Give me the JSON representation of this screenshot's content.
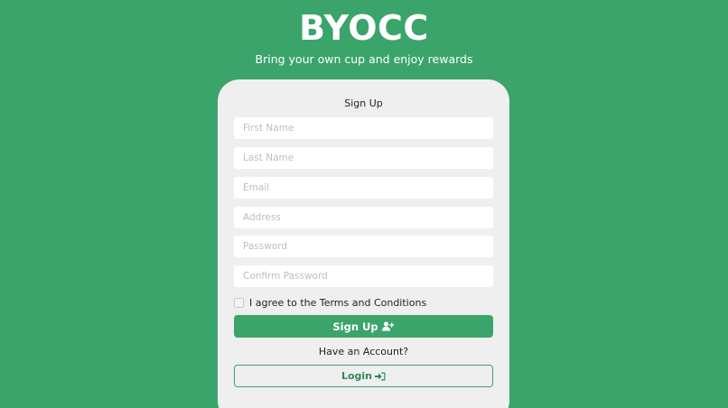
{
  "header": {
    "brand": "BYOCC",
    "tagline": "Bring your own cup and enjoy rewards"
  },
  "form": {
    "title": "Sign Up",
    "fields": [
      {
        "name": "first-name",
        "placeholder": "First Name",
        "value": ""
      },
      {
        "name": "last-name",
        "placeholder": "Last Name",
        "value": ""
      },
      {
        "name": "email",
        "placeholder": "Email",
        "value": ""
      },
      {
        "name": "address",
        "placeholder": "Address",
        "value": ""
      },
      {
        "name": "password",
        "placeholder": "Password",
        "value": ""
      },
      {
        "name": "confirm-password",
        "placeholder": "Confirm Password",
        "value": ""
      }
    ],
    "agree_label": "I agree to the Terms and Conditions",
    "agree_checked": false,
    "signup_label": "Sign Up",
    "signup_icon": "user-plus-icon",
    "have_account": "Have an Account?",
    "login_label": "Login",
    "login_icon": "sign-in-icon"
  },
  "colors": {
    "background": "#3aa46b",
    "card": "#efefef",
    "accent": "#3aa46b"
  }
}
